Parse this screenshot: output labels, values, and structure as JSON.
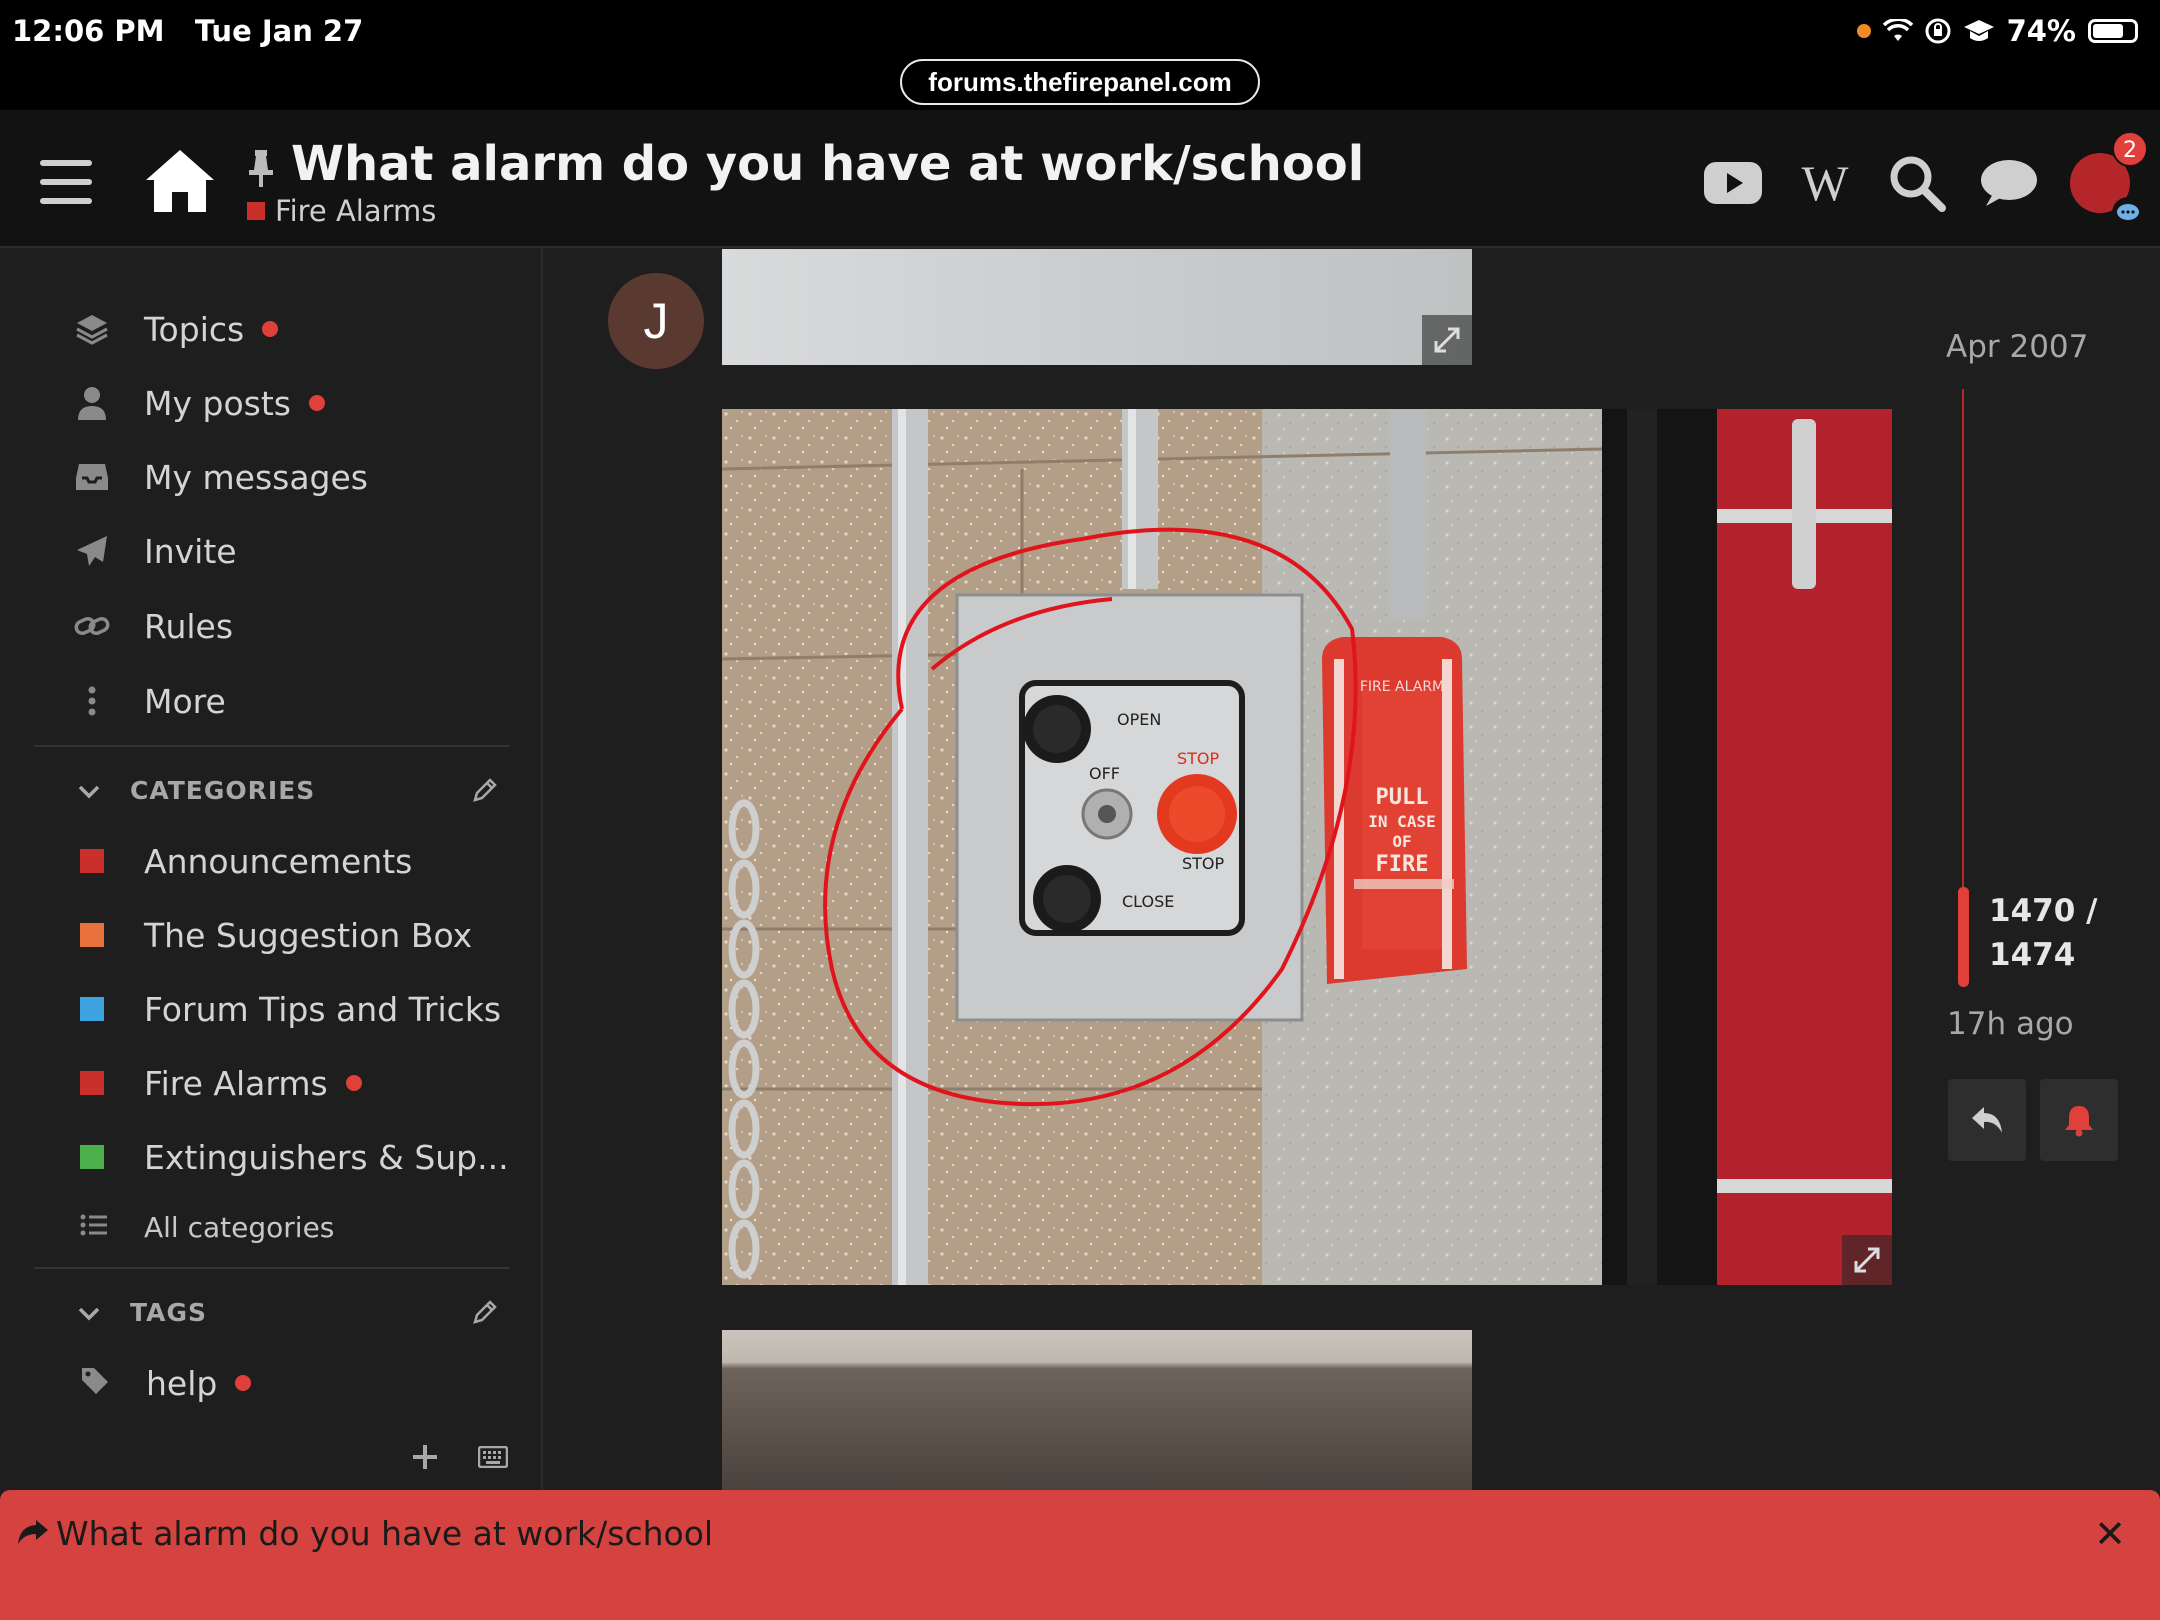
{
  "status_bar": {
    "time": "12:06 PM",
    "date": "Tue Jan 27",
    "battery": "74%",
    "url": "forums.thefirepanel.com"
  },
  "header": {
    "title": "What alarm do you have at work/school",
    "category": "Fire Alarms",
    "notification_count": "2"
  },
  "sidebar": {
    "nav": [
      {
        "label": "Topics",
        "unread": true
      },
      {
        "label": "My posts",
        "unread": true
      },
      {
        "label": "My messages",
        "unread": false
      },
      {
        "label": "Invite",
        "unread": false
      },
      {
        "label": "Rules",
        "unread": false
      },
      {
        "label": "More",
        "unread": false
      }
    ],
    "categories_header": "CATEGORIES",
    "categories": [
      {
        "label": "Announcements",
        "color": "#c9302c"
      },
      {
        "label": "The Suggestion Box",
        "color": "#e8703a"
      },
      {
        "label": "Forum Tips and Tricks",
        "color": "#3ea3e0"
      },
      {
        "label": "Fire Alarms",
        "color": "#c9302c",
        "unread": true
      },
      {
        "label": "Extinguishers & Sup...",
        "color": "#4cb04a"
      }
    ],
    "all_categories": "All categories",
    "tags_header": "TAGS",
    "tags": [
      {
        "label": "help",
        "unread": true
      }
    ]
  },
  "post": {
    "avatar_letter": "J",
    "photo_labels": {
      "open": "OPEN",
      "off": "OFF",
      "stop_top": "STOP",
      "stop_bottom": "STOP",
      "close": "CLOSE",
      "fire_alarm": "FIRE ALARM",
      "pull_lines": [
        "PULL",
        "IN CASE",
        "OF",
        "FIRE"
      ]
    }
  },
  "timeline": {
    "date": "Apr 2007",
    "position": "1470 /",
    "total": "1474",
    "ago": "17h ago"
  },
  "banner": {
    "text": "What alarm do you have at work/school"
  }
}
